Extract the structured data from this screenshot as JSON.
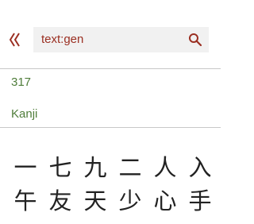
{
  "search": {
    "back_icon": "back-chevron-icon",
    "query": "text:gen",
    "search_icon": "search-icon",
    "accent_color": "#9b2f22"
  },
  "results": {
    "count": "317",
    "category": "Kanji",
    "label_color": "#4f7d3a",
    "kanji_rows": [
      [
        "一",
        "七",
        "九",
        "二",
        "人",
        "入"
      ],
      [
        "午",
        "友",
        "天",
        "少",
        "心",
        "手"
      ]
    ]
  }
}
